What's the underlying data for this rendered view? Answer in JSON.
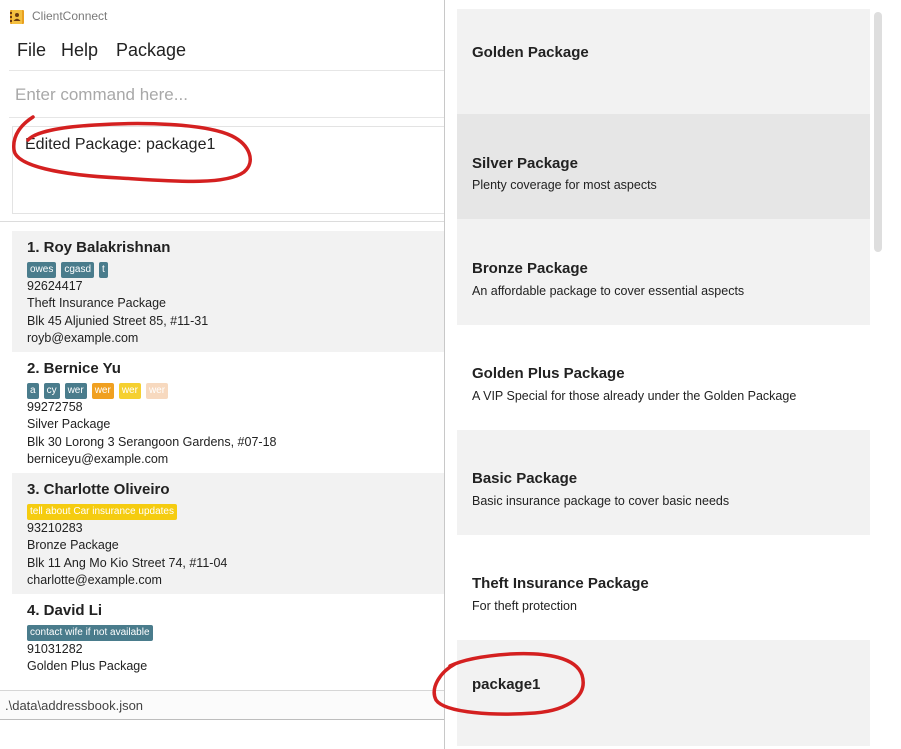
{
  "window": {
    "title": "ClientConnect"
  },
  "menu": [
    {
      "label": "File"
    },
    {
      "label": "Help"
    },
    {
      "label": "Package"
    }
  ],
  "command": {
    "placeholder": "Enter command here...",
    "value": ""
  },
  "result": {
    "text": "Edited Package: package1"
  },
  "persons": [
    {
      "name": "1.  Roy Balakrishnan",
      "tags": [
        {
          "label": "owes",
          "color": "#4a7c8c"
        },
        {
          "label": "cgasd",
          "color": "#4a7c8c"
        },
        {
          "label": "t",
          "color": "#4a7c8c"
        }
      ],
      "phone": "92624417",
      "package": "Theft Insurance Package",
      "address": "Blk 45 Aljunied Street 85, #11-31",
      "email": "royb@example.com"
    },
    {
      "name": "2.  Bernice Yu",
      "tags": [
        {
          "label": "a",
          "color": "#4a7c8c"
        },
        {
          "label": "cy",
          "color": "#4a7c8c"
        },
        {
          "label": "wer",
          "color": "#4a7c8c"
        },
        {
          "label": "wer",
          "color": "#f0a020"
        },
        {
          "label": "wer",
          "color": "#f5d030"
        },
        {
          "label": "wer",
          "color": "#f7d9bf"
        }
      ],
      "phone": "99272758",
      "package": "Silver Package",
      "address": "Blk 30 Lorong 3 Serangoon Gardens, #07-18",
      "email": "berniceyu@example.com"
    },
    {
      "name": "3.  Charlotte Oliveiro",
      "tags": [
        {
          "label": "tell about Car insurance updates",
          "color": "#f5cc10"
        }
      ],
      "phone": "93210283",
      "package": "Bronze Package",
      "address": "Blk 11 Ang Mo Kio Street 74, #11-04",
      "email": "charlotte@example.com"
    },
    {
      "name": "4.  David Li",
      "tags": [
        {
          "label": "contact wife if not available",
          "color": "#4a7c8c"
        }
      ],
      "phone": "91031282",
      "package": "Golden Plus Package",
      "address": "",
      "email": ""
    }
  ],
  "status": {
    "path": ".\\data\\addressbook.json"
  },
  "packages": [
    {
      "name": "Golden Package",
      "description": ""
    },
    {
      "name": "Silver Package",
      "description": "Plenty coverage for most aspects"
    },
    {
      "name": "Bronze Package",
      "description": "An affordable package to cover essential aspects"
    },
    {
      "name": "Golden Plus Package",
      "description": "A VIP Special for those already under the Golden Package"
    },
    {
      "name": "Basic Package",
      "description": "Basic insurance package to cover basic needs"
    },
    {
      "name": "Theft Insurance Package",
      "description": "For theft protection"
    },
    {
      "name": "package1",
      "description": ""
    }
  ],
  "colors": {
    "annotation": "#d42020",
    "tag_default": "#4a7c8c"
  }
}
